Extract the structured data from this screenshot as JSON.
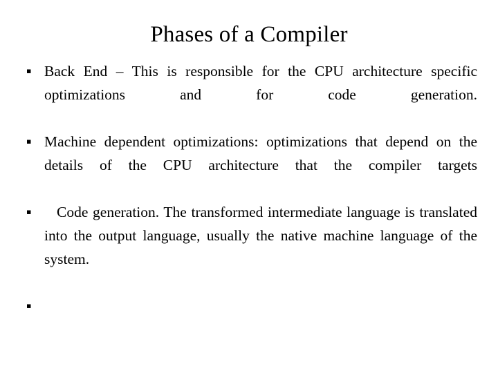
{
  "slide": {
    "title": "Phases of a Compiler",
    "background_color": "#ffffff",
    "text_color": "#000000",
    "bullet_glyph": "▪",
    "bullets": [
      {
        "text": "Back End – This is responsible for the CPU architecture specific optimizations and for code generation.",
        "indented": false,
        "empty": false
      },
      {
        "text": "Machine dependent optimizations: optimizations that depend on the details of the CPU architecture that the compiler targets",
        "indented": false,
        "empty": false
      },
      {
        "text": "Code generation. The transformed intermediate language is translated into the output language, usually the native machine language of the system.",
        "indented": true,
        "empty": false
      },
      {
        "text": "",
        "indented": false,
        "empty": true
      }
    ]
  }
}
